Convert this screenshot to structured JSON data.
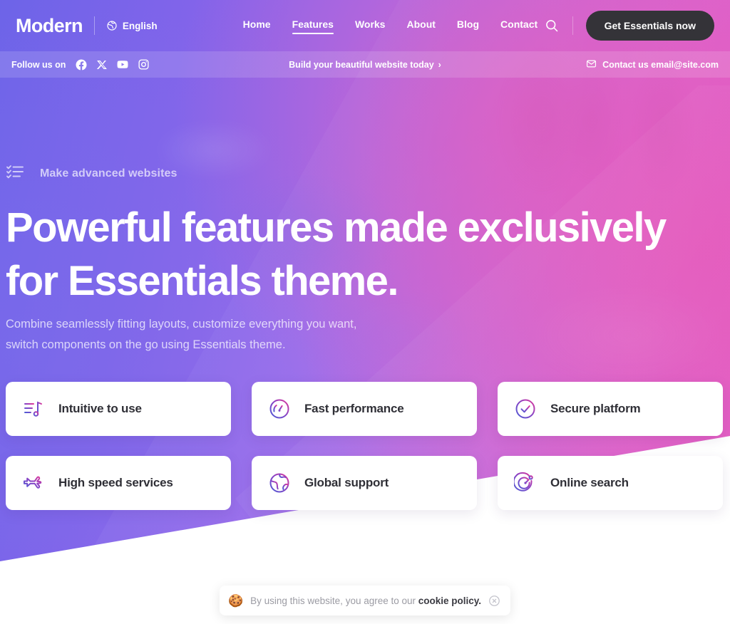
{
  "colors": {
    "gradient_start": "#6c63e8",
    "gradient_mid": "#9e6bea",
    "gradient_end": "#e45bc8",
    "cta_dark": "#343338",
    "card_bg": "#ffffff",
    "card_title": "#2f2f36",
    "icon_gradient_from": "#4f5bd5",
    "icon_gradient_to": "#e0399a",
    "cookie_text": "#9b9ba3"
  },
  "topnav": {
    "brand": "Modern",
    "language": {
      "label": "English",
      "icon": "globe-icon"
    },
    "links": [
      {
        "label": "Home",
        "active": false
      },
      {
        "label": "Features",
        "active": true
      },
      {
        "label": "Works",
        "active": false
      },
      {
        "label": "About",
        "active": false
      },
      {
        "label": "Blog",
        "active": false
      },
      {
        "label": "Contact",
        "active": false
      }
    ],
    "search_icon": "search-icon",
    "cta_label": "Get Essentials now"
  },
  "announce": {
    "follow_label": "Follow us on",
    "socials": [
      {
        "name": "facebook-icon"
      },
      {
        "name": "x-twitter-icon"
      },
      {
        "name": "youtube-icon"
      },
      {
        "name": "instagram-icon"
      }
    ],
    "center_text": "Build your beautiful website today",
    "center_chevron": "›",
    "contact_icon": "mail-icon",
    "contact_text": "Contact us email@site.com"
  },
  "hero": {
    "eyebrow_icon": "checklist-icon",
    "eyebrow": "Make advanced websites",
    "title": "Powerful features made exclusively for Essentials theme.",
    "subtitle": "Combine seamlessly fitting layouts, customize everything you want, switch components on the go using Essentials theme."
  },
  "features": [
    {
      "title": "Intuitive to use",
      "icon": "music-playlist-icon"
    },
    {
      "title": "Fast performance",
      "icon": "speedometer-icon"
    },
    {
      "title": "Secure platform",
      "icon": "check-circle-icon"
    },
    {
      "title": "High speed services",
      "icon": "airplane-icon"
    },
    {
      "title": "Global support",
      "icon": "globe-icon"
    },
    {
      "title": "Online search",
      "icon": "radar-target-icon"
    }
  ],
  "cookie": {
    "emoji": "🍪",
    "text_before": "By using this website, you agree to our ",
    "link_text": "cookie policy.",
    "close_icon": "close-circle-icon"
  }
}
